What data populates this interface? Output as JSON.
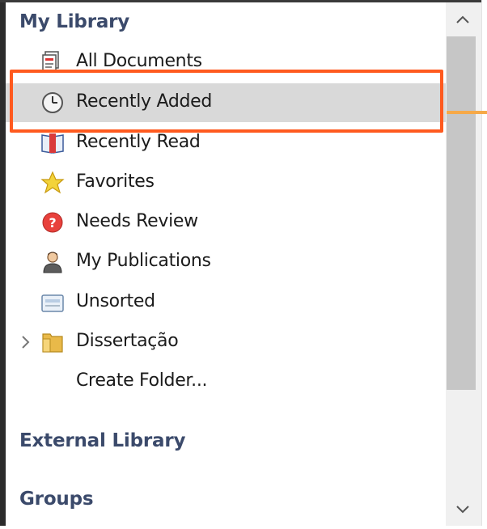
{
  "library": {
    "heading": "My Library",
    "items": [
      {
        "label": "All Documents",
        "icon": "documents-icon"
      },
      {
        "label": "Recently Added",
        "icon": "clock-icon",
        "selected": true
      },
      {
        "label": "Recently Read",
        "icon": "open-book-icon"
      },
      {
        "label": "Favorites",
        "icon": "star-icon"
      },
      {
        "label": "Needs Review",
        "icon": "question-mark-icon"
      },
      {
        "label": "My Publications",
        "icon": "person-icon"
      },
      {
        "label": "Unsorted",
        "icon": "tray-icon"
      },
      {
        "label": "Dissertação",
        "icon": "folder-icon",
        "expandable": true
      },
      {
        "label": "Create Folder..."
      }
    ]
  },
  "external": {
    "heading": "External Library"
  },
  "groups": {
    "heading": "Groups"
  },
  "colors": {
    "heading": "#3b4a6b",
    "selected_row": "#d9d9d9",
    "highlight_box": "#ff5a1f",
    "callout": "#f6a948",
    "scroll_thumb": "#c6c6c6"
  },
  "scrollbar": {
    "up_icon": "chevron-up-icon",
    "down_icon": "chevron-down-icon"
  }
}
